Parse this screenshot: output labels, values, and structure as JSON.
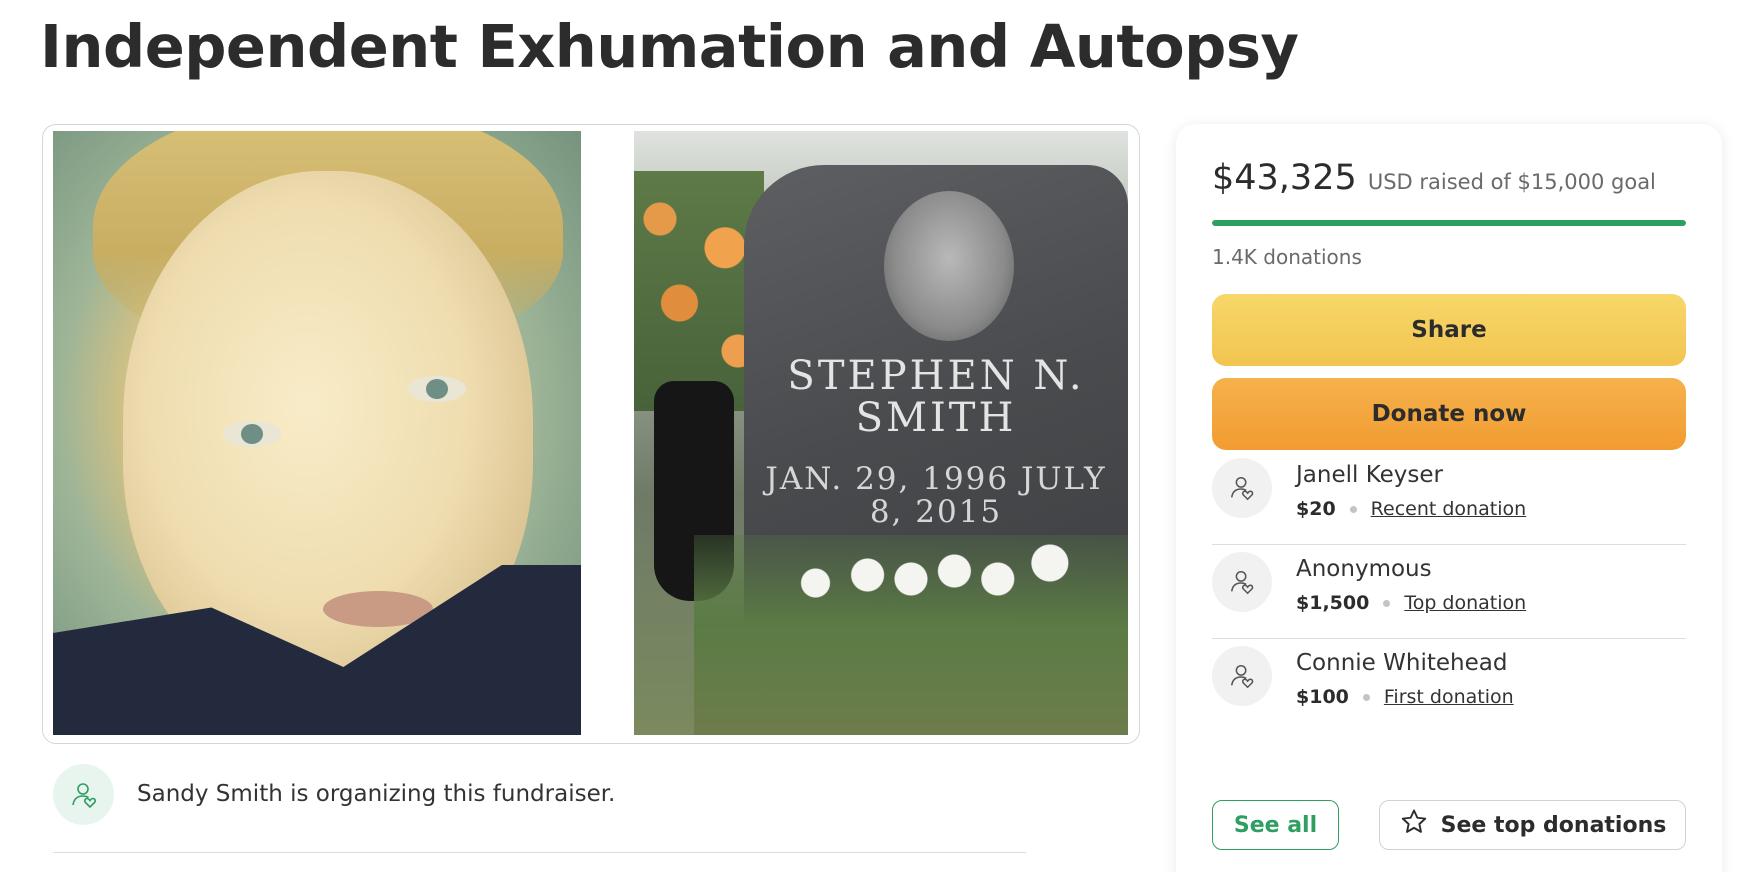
{
  "page": {
    "title": "Independent Exhumation and Autopsy"
  },
  "hero": {
    "tombstone_name": "STEPHEN N. SMITH",
    "tombstone_dates": "JAN. 29, 1996 JULY 8, 2015"
  },
  "organizer": {
    "text": "Sandy Smith is organizing this fundraiser.",
    "avatar_icon": "user-heart-icon"
  },
  "donation_card": {
    "raised_amount": "$43,325",
    "raised_meta": "USD raised of $15,000 goal",
    "progress_fraction": 1.0,
    "progress_color": "#2f9e61",
    "donation_count": "1.4K donations",
    "share_label": "Share",
    "donate_label": "Donate now",
    "donors": [
      {
        "name": "Janell Keyser",
        "amount": "$20",
        "tag": "Recent donation"
      },
      {
        "name": "Anonymous",
        "amount": "$1,500",
        "tag": "Top donation"
      },
      {
        "name": "Connie Whitehead",
        "amount": "$100",
        "tag": "First donation"
      }
    ],
    "see_all_label": "See all",
    "see_top_label": "See top donations"
  },
  "colors": {
    "accent_green": "#2f9e61",
    "share_yellow": "#f2c450",
    "donate_orange": "#f19c30"
  }
}
